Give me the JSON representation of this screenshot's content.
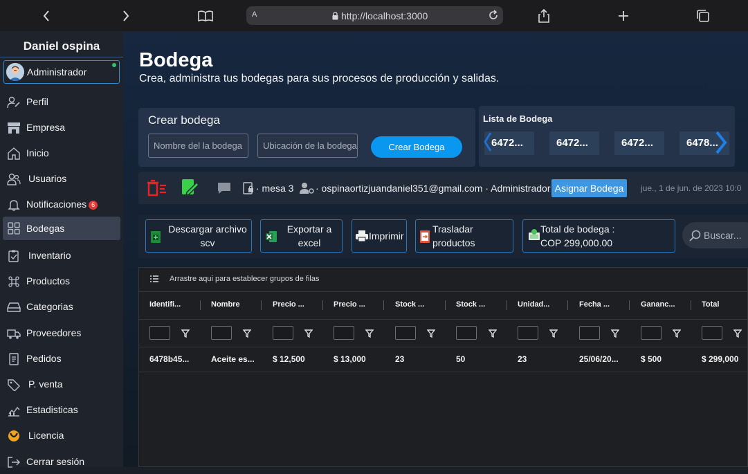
{
  "browser": {
    "url": "http://localhost:3000",
    "reader_label": "A"
  },
  "sidebar": {
    "user_name": "Daniel ospina",
    "role": "Administrador",
    "items": [
      {
        "label": "Perfil",
        "icon": "user-edit-icon"
      },
      {
        "label": "Empresa",
        "icon": "store-icon"
      },
      {
        "label": "Inicio",
        "icon": "home-icon"
      },
      {
        "label": "Usuarios",
        "icon": "users-icon"
      },
      {
        "label": "Notificaciones",
        "icon": "bell-icon",
        "badge": "6"
      },
      {
        "label": "Bodegas",
        "icon": "grid-icon",
        "active": true
      },
      {
        "label": "Inventario",
        "icon": "clipboard-icon"
      },
      {
        "label": "Productos",
        "icon": "command-icon"
      },
      {
        "label": "Categorias",
        "icon": "drive-icon"
      },
      {
        "label": "Proveedores",
        "icon": "truck-icon"
      },
      {
        "label": "Pedidos",
        "icon": "document-icon"
      },
      {
        "label": "P. venta",
        "icon": "tag-icon"
      },
      {
        "label": "Estadisticas",
        "icon": "chart-icon"
      },
      {
        "label": "Licencia",
        "icon": "license-icon"
      },
      {
        "label": "Cerrar sesión",
        "icon": "logout-icon"
      }
    ]
  },
  "header": {
    "title": "Bodega",
    "subtitle": "Crea, administra tus bodegas para sus procesos de producción y salidas."
  },
  "create": {
    "title": "Crear bodega",
    "name_placeholder": "Nombre del la bodega",
    "location_placeholder": "Ubicación de la bodega",
    "button": "Crear Bodega"
  },
  "warehouse_list": {
    "title": "Lista de Bodega",
    "items": [
      "6472...",
      "6472...",
      "6472...",
      "6478..."
    ]
  },
  "info_bar": {
    "table": "· mesa 3",
    "user": "· ospinaortizjuandaniel351@gmail.com · Administrador",
    "assign_button": "Asignar Bodega",
    "date": "jue., 1 de jun. de 2023 10:0"
  },
  "toolbar": {
    "download": "Descargar archivo scv",
    "download_l1": "Descargar archivo",
    "download_l2": "scv",
    "export_l1": "Exportar a",
    "export_l2": "excel",
    "print": "Imprimir",
    "move_l1": "Trasladar",
    "move_l2": "productos",
    "total_l1": "Total de bodega :",
    "total_l2": "COP 299,000.00",
    "search": "Buscar..."
  },
  "grid": {
    "group_hint": "Arrastre aqui para establecer grupos de filas",
    "columns": [
      "Identifi...",
      "Nombre",
      "Precio ...",
      "Precio ...",
      "Stock ...",
      "Stock ...",
      "Unidad...",
      "Fecha ...",
      "Gananc...",
      "Total"
    ],
    "rows": [
      [
        "6478b45...",
        "Aceite es...",
        "$ 12,500",
        "$ 13,000",
        "23",
        "50",
        "23",
        "25/06/20...",
        "$ 500",
        "$ 299,000"
      ]
    ]
  },
  "colors": {
    "accent": "#0a97f0",
    "assign": "#3d97e3",
    "sidebar_bg": "#1f232c",
    "badge": "#e53935"
  }
}
